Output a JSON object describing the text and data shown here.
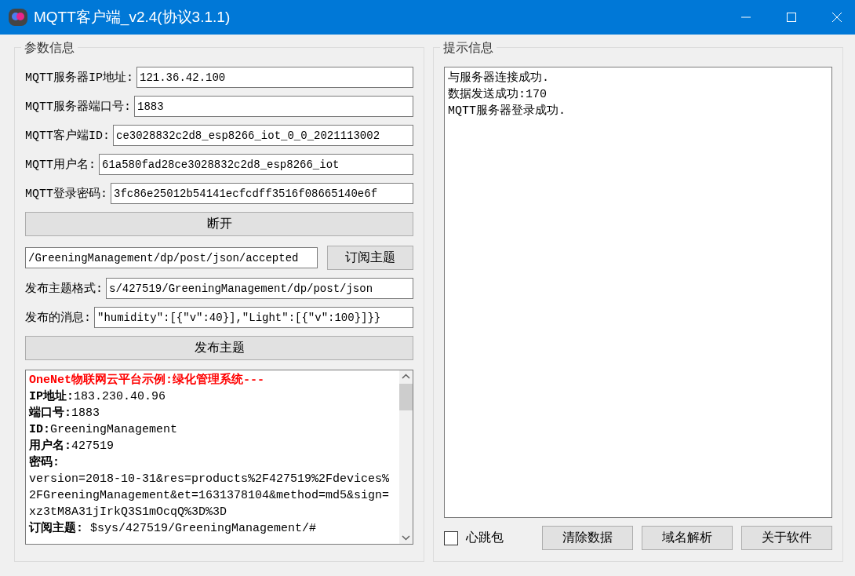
{
  "window": {
    "title": "MQTT客户端_v2.4(协议3.1.1)"
  },
  "params": {
    "title": "参数信息",
    "fields": [
      {
        "label": "MQTT服务器IP地址:",
        "value": "121.36.42.100"
      },
      {
        "label": "MQTT服务器端口号:",
        "value": "1883"
      },
      {
        "label": "MQTT客户端ID:",
        "value": "ce3028832c2d8_esp8266_iot_0_0_2021113002"
      },
      {
        "label": "MQTT用户名:",
        "value": "61a580fad28ce3028832c2d8_esp8266_iot"
      },
      {
        "label": "MQTT登录密码:",
        "value": "3fc86e25012b54141ecfcdff3516f08665140e6f"
      }
    ],
    "connect_button": "断开",
    "subscribe_topic": "/GreeningManagement/dp/post/json/accepted",
    "subscribe_button": "订阅主题",
    "publish_fields": [
      {
        "label": "发布主题格式:",
        "value": "s/427519/GreeningManagement/dp/post/json"
      },
      {
        "label": "发布的消息:",
        "value": "\"humidity\":[{\"v\":40}],\"Light\":[{\"v\":100}]}}"
      }
    ],
    "publish_button": "发布主题",
    "notes": [
      {
        "kind": "heading",
        "text": "OneNet物联网云平台示例:绿化管理系统---"
      },
      {
        "kind": "pair",
        "label": "IP地址:",
        "value": "183.230.40.96"
      },
      {
        "kind": "pair",
        "label": "端口号:",
        "value": "1883"
      },
      {
        "kind": "pair",
        "label": "ID:",
        "value": "GreeningManagement"
      },
      {
        "kind": "pair",
        "label": "用户名:",
        "value": "427519"
      },
      {
        "kind": "pair",
        "label": "密码:"
      },
      {
        "kind": "plain",
        "text": "version=2018-10-31&res=products%2F427519%2Fdevices%2FGreeningManagement&et=1631378104&method=md5&sign=xz3tM8A31jIrkQ3S1mOcqQ%3D%3D"
      },
      {
        "kind": "pair",
        "label": "订阅主题:",
        "value": " $sys/427519/GreeningManagement/#"
      }
    ]
  },
  "info": {
    "title": "提示信息",
    "log": [
      "与服务器连接成功.",
      "数据发送成功:170",
      "MQTT服务器登录成功."
    ],
    "heartbeat": {
      "label": "心跳包",
      "checked": false
    },
    "buttons": [
      "清除数据",
      "域名解析",
      "关于软件"
    ]
  }
}
